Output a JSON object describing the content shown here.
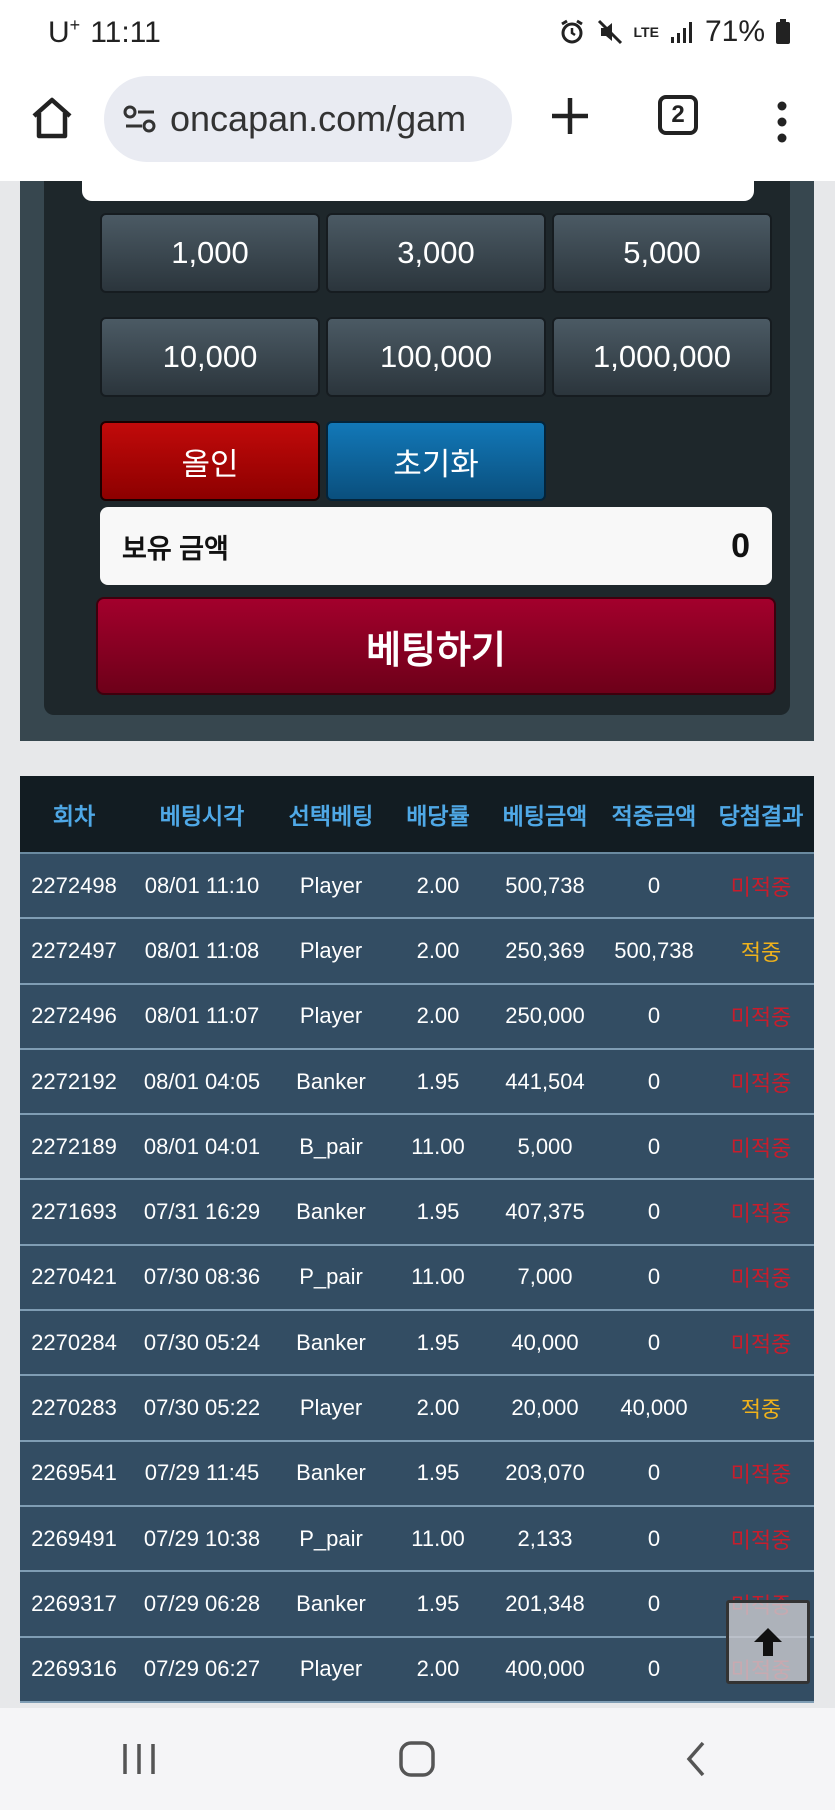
{
  "status_bar": {
    "carrier": "U",
    "carrier_sup": "+",
    "time": "11:11",
    "network": "LTE",
    "battery": "71%"
  },
  "browser": {
    "url": "oncapan.com/gam",
    "tab_count": "2"
  },
  "bet_panel": {
    "chips": [
      "1,000",
      "3,000",
      "5,000",
      "10,000",
      "100,000",
      "1,000,000"
    ],
    "all_in_label": "올인",
    "reset_label": "초기화",
    "balance_label": "보유 금액",
    "balance_value": "0",
    "submit_label": "베팅하기"
  },
  "history": {
    "columns": [
      "회차",
      "베팅시각",
      "선택베팅",
      "배당률",
      "베팅금액",
      "적중금액",
      "당첨결과"
    ],
    "rows": [
      [
        "2272498",
        "08/01 11:10",
        "Player",
        "2.00",
        "500,738",
        "0",
        "미적중"
      ],
      [
        "2272497",
        "08/01 11:08",
        "Player",
        "2.00",
        "250,369",
        "500,738",
        "적중"
      ],
      [
        "2272496",
        "08/01 11:07",
        "Player",
        "2.00",
        "250,000",
        "0",
        "미적중"
      ],
      [
        "2272192",
        "08/01 04:05",
        "Banker",
        "1.95",
        "441,504",
        "0",
        "미적중"
      ],
      [
        "2272189",
        "08/01 04:01",
        "B_pair",
        "11.00",
        "5,000",
        "0",
        "미적중"
      ],
      [
        "2271693",
        "07/31 16:29",
        "Banker",
        "1.95",
        "407,375",
        "0",
        "미적중"
      ],
      [
        "2270421",
        "07/30 08:36",
        "P_pair",
        "11.00",
        "7,000",
        "0",
        "미적중"
      ],
      [
        "2270284",
        "07/30 05:24",
        "Banker",
        "1.95",
        "40,000",
        "0",
        "미적중"
      ],
      [
        "2270283",
        "07/30 05:22",
        "Player",
        "2.00",
        "20,000",
        "40,000",
        "적중"
      ],
      [
        "2269541",
        "07/29 11:45",
        "Banker",
        "1.95",
        "203,070",
        "0",
        "미적중"
      ],
      [
        "2269491",
        "07/29 10:38",
        "P_pair",
        "11.00",
        "2,133",
        "0",
        "미적중"
      ],
      [
        "2269317",
        "07/29 06:28",
        "Banker",
        "1.95",
        "201,348",
        "0",
        "미적중"
      ],
      [
        "2269316",
        "07/29 06:27",
        "Player",
        "2.00",
        "400,000",
        "0",
        "미적중"
      ]
    ]
  },
  "colors": {
    "win": "#f0b21b",
    "lose": "#c71d2c",
    "header_text": "#4fa8e6",
    "row_bg": "#334d63"
  }
}
